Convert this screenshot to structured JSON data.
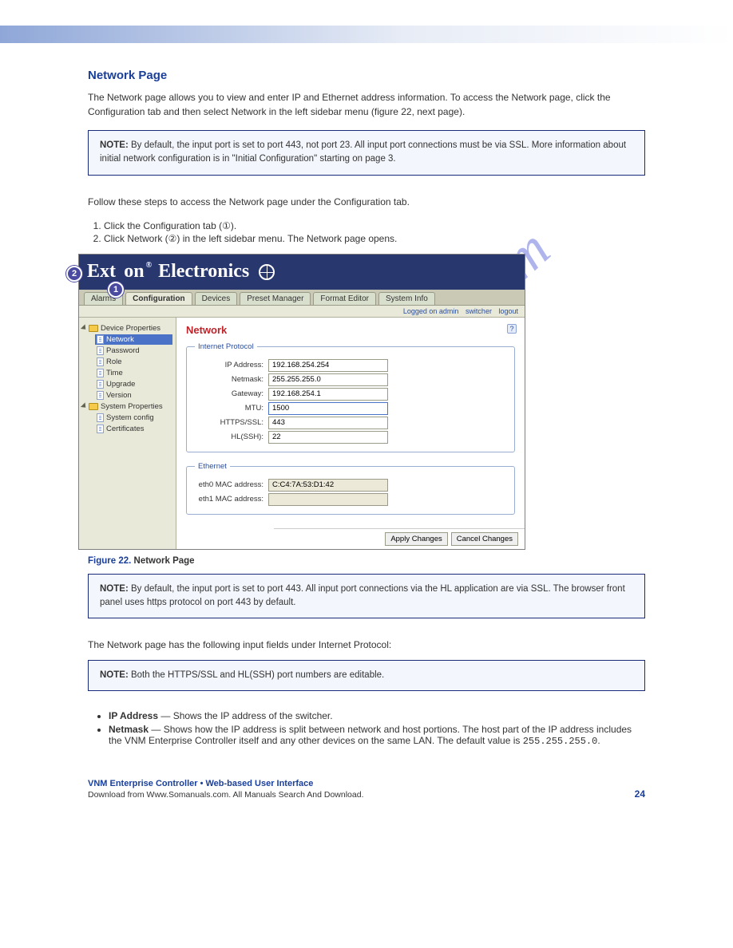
{
  "section_title": "Network Page",
  "intro": "The Network page allows you to view and enter IP and Ethernet address information. To access the Network page, click the Configuration tab and then select Network in the left sidebar menu (figure 22, next page).",
  "note1_label": "NOTE:",
  "note1_text": " By default, the input port is set to port 443, not port 23. All input port connections must be via SSL. More information about initial network configuration is in \"Initial Configuration\" starting on page 3.",
  "steps_intro": "Follow these steps to access the Network page under the Configuration tab.",
  "steps": [
    "Click the Configuration tab (①).",
    "Click Network (②) in the left sidebar menu. The Network page opens."
  ],
  "screenshot": {
    "brand_part1": "Ext",
    "brand_part2": "on",
    "brand_reg": "®",
    "brand_word2": "Electronics",
    "tabs": [
      "Alarms",
      "Configuration",
      "Devices",
      "Preset Manager",
      "Format Editor",
      "System Info"
    ],
    "active_tab_index": 1,
    "login": {
      "text": "Logged on admin",
      "switcher": "switcher",
      "logout": "logout"
    },
    "tree": {
      "folder1": "Device Properties",
      "folder2": "System Properties",
      "items1": [
        "Network",
        "Password",
        "Role",
        "Time",
        "Upgrade",
        "Version"
      ],
      "items2": [
        "System config",
        "Certificates"
      ],
      "selected": "Network"
    },
    "page_title": "Network",
    "help": "?",
    "group1": {
      "legend": "Internet Protocol",
      "rows": [
        {
          "label": "IP Address:",
          "value": "192.168.254.254",
          "ro": false
        },
        {
          "label": "Netmask:",
          "value": "255.255.255.0",
          "ro": false
        },
        {
          "label": "Gateway:",
          "value": "192.168.254.1",
          "ro": false
        },
        {
          "label": "MTU:",
          "value": "1500",
          "ro": false,
          "hi": true
        },
        {
          "label": "HTTPS/SSL:",
          "value": "443",
          "ro": false
        },
        {
          "label": "HL(SSH):",
          "value": "22",
          "ro": false
        }
      ]
    },
    "group2": {
      "legend": "Ethernet",
      "rows": [
        {
          "label": "eth0 MAC address:",
          "value": "C:C4:7A:53:D1:42",
          "ro": true
        },
        {
          "label": "eth1 MAC address:",
          "value": "",
          "ro": true
        }
      ]
    },
    "buttons": {
      "apply": "Apply Changes",
      "cancel": "Cancel Changes"
    }
  },
  "figcaption_num": "Figure 22.",
  "figcaption_text": " Network Page",
  "note2_label": "NOTE:",
  "note2_text": " By default, the input port is set to port 443. All input port connections via the HL application are via SSL. The browser front panel uses https protocol on port 443 by default.",
  "bullets_intro": "The Network page has the following input fields under Internet Protocol:",
  "note3_label": "NOTE:",
  "note3_text": " Both the HTTPS/SSL and HL(SSH) port numbers are editable.",
  "bullets": {
    "b1_label": "IP Address",
    "b1_text": " — Shows the IP address of the switcher.",
    "b2_label": "Netmask",
    "b2_text": " — Shows how the IP address is split between network and host portions. The host part of the IP address includes the VNM Enterprise Controller itself and any other devices on the same LAN. The default value is ",
    "b2_code": "255.255.255.0",
    "b2_tail": "."
  },
  "watermark": "manualshive.com",
  "footer": {
    "title": "VNM Enterprise Controller • Web-based User Interface",
    "sub": "Download from Www.Somanuals.com. All Manuals Search And Download.",
    "page": "24"
  }
}
